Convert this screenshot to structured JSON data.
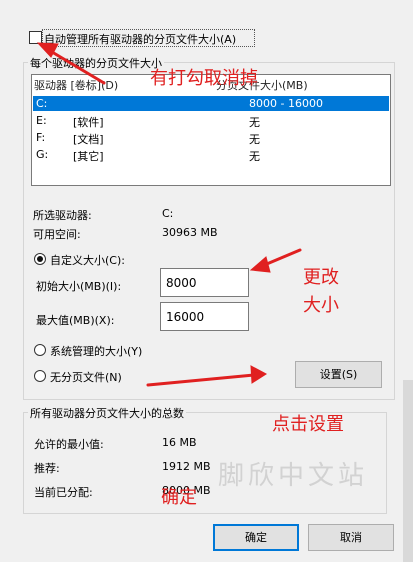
{
  "top": {
    "auto_manage_label": "自动管理所有驱动器的分页文件大小(A)"
  },
  "per_drive": {
    "group_title": "每个驱动器的分页文件大小",
    "header_drive": "驱动器 [卷标](D)",
    "header_size": "分页文件大小(MB)",
    "rows": [
      {
        "drive": "C:",
        "label": "",
        "size": "8000 - 16000"
      },
      {
        "drive": "E:",
        "label": "[软件]",
        "size": "无"
      },
      {
        "drive": "F:",
        "label": "[文档]",
        "size": "无"
      },
      {
        "drive": "G:",
        "label": "[其它]",
        "size": "无"
      }
    ],
    "selected_drive_label": "所选驱动器:",
    "selected_drive_value": "C:",
    "free_space_label": "可用空间:",
    "free_space_value": "30963 MB",
    "custom_size_label": "自定义大小(C):",
    "initial_size_label": "初始大小(MB)(I):",
    "initial_size_value": "8000",
    "max_size_label": "最大值(MB)(X):",
    "max_size_value": "16000",
    "system_managed_label": "系统管理的大小(Y)",
    "no_paging_label": "无分页文件(N)",
    "set_button": "设置(S)"
  },
  "totals": {
    "group_title": "所有驱动器分页文件大小的总数",
    "min_allowed_label": "允许的最小值:",
    "min_allowed_value": "16 MB",
    "recommended_label": "推荐:",
    "recommended_value": "1912 MB",
    "current_label": "当前已分配:",
    "current_value": "8000 MB"
  },
  "buttons": {
    "ok": "确定",
    "cancel": "取消"
  },
  "annotations": {
    "uncheck": "有打勾取消掉",
    "change_size_1": "更改",
    "change_size_2": "大小",
    "click_set": "点击设置",
    "ok_hint": "确定",
    "color": "#e02020"
  },
  "watermark": "脚欣中文站"
}
